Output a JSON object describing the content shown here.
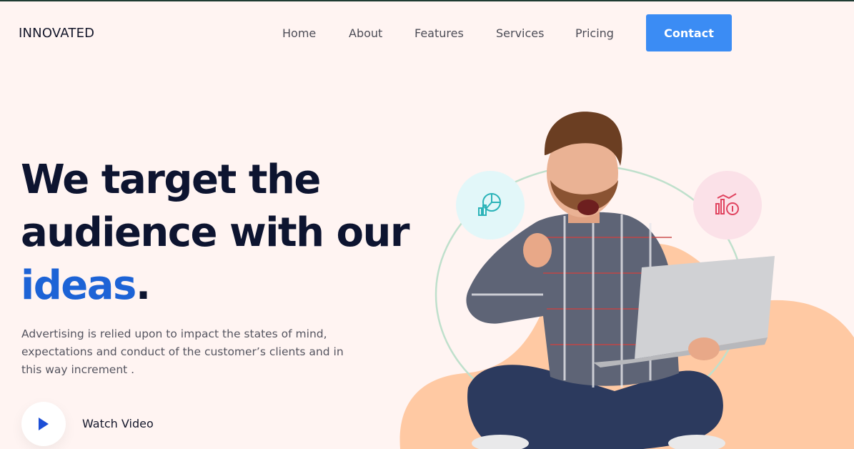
{
  "brand": {
    "logo": "INNOVATED"
  },
  "nav": {
    "items": [
      {
        "label": "Home"
      },
      {
        "label": "About"
      },
      {
        "label": "Features"
      },
      {
        "label": "Services"
      },
      {
        "label": "Pricing"
      }
    ],
    "contact_label": "Contact"
  },
  "hero": {
    "headline_line1": "We target the",
    "headline_line2": "audience with our",
    "headline_accent": "ideas",
    "headline_period": ".",
    "description": "Advertising is relied upon to impact the states of mind, expectations and conduct of the customer’s clients and in this way increment .",
    "watch_label": "Watch Video"
  },
  "icons": {
    "play": "play-icon",
    "left_badge": "pie-chart-icon",
    "right_badge": "growth-chart-icon"
  },
  "colors": {
    "background": "#fff4f2",
    "primary_button": "#3b8cf4",
    "accent_text": "#1d63d6",
    "heading": "#0d1430",
    "blob": "#ffc69e",
    "teal_badge": "#e2f7f9",
    "pink_badge": "#fbe1e8"
  }
}
